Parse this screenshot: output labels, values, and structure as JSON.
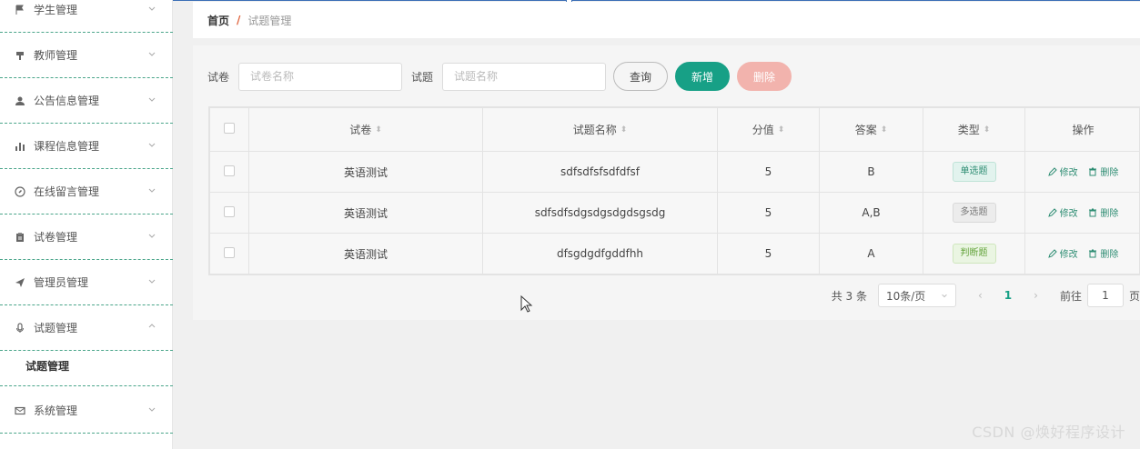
{
  "sidebar": {
    "items": [
      {
        "label": "学生管理",
        "icon": "flag-icon"
      },
      {
        "label": "教师管理",
        "icon": "podium-icon"
      },
      {
        "label": "公告信息管理",
        "icon": "user-icon"
      },
      {
        "label": "课程信息管理",
        "icon": "bar-chart-icon"
      },
      {
        "label": "在线留言管理",
        "icon": "compass-icon"
      },
      {
        "label": "试卷管理",
        "icon": "clipboard-icon"
      },
      {
        "label": "管理员管理",
        "icon": "send-icon"
      },
      {
        "label": "试题管理",
        "icon": "mic-icon"
      },
      {
        "label": "系统管理",
        "icon": "mail-icon"
      }
    ],
    "sub_item": "试题管理"
  },
  "breadcrumb": {
    "home": "首页",
    "separator": "/",
    "current": "试题管理"
  },
  "search": {
    "paper_label": "试卷",
    "paper_placeholder": "试卷名称",
    "question_label": "试题",
    "question_placeholder": "试题名称",
    "query_button": "查询",
    "add_button": "新增",
    "delete_button": "删除"
  },
  "table": {
    "headers": [
      "试卷",
      "试题名称",
      "分值",
      "答案",
      "类型",
      "操作"
    ],
    "rows": [
      {
        "paper": "英语测试",
        "name": "sdfsdfsfsdfdfsf",
        "score": "5",
        "answer": "B",
        "type": "单选题"
      },
      {
        "paper": "英语测试",
        "name": "sdfsdfsdgsdgsdgdsgsdg",
        "score": "5",
        "answer": "A,B",
        "type": "多选题"
      },
      {
        "paper": "英语测试",
        "name": "dfsgdgdfgddfhh",
        "score": "5",
        "answer": "A",
        "type": "判断题"
      }
    ],
    "edit_label": "修改",
    "delete_label": "删除"
  },
  "pagination": {
    "total": "共 3 条",
    "page_size": "10条/页",
    "prev": "‹",
    "current_page": "1",
    "next": "›",
    "goto_label": "前往",
    "goto_value": "1",
    "page_suffix": "页"
  },
  "watermark": "CSDN @焕好程序设计",
  "colors": {
    "accent": "#17a086",
    "danger_light": "#f2b3ad",
    "breadcrumb_sep": "#e0633d"
  }
}
